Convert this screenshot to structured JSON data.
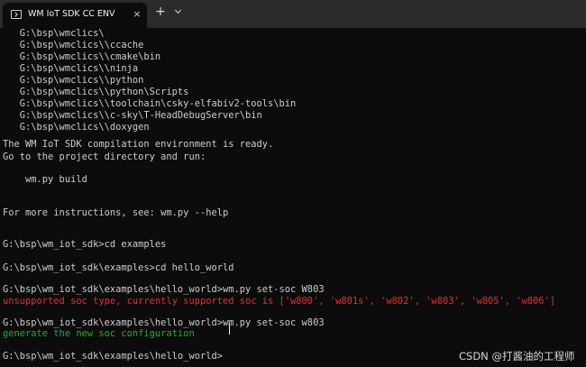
{
  "window": {
    "tab_title": "WM IoT SDK CC ENV",
    "tab_icon": "terminal-icon",
    "close_icon": "×",
    "new_tab_icon": "+",
    "dropdown_icon": "chevron-down-icon",
    "colors": {
      "background": "#0c0c0c",
      "text": "#cccccc",
      "error": "#e0322f",
      "success": "#1fae30"
    }
  },
  "terminal": {
    "lines": [
      "   G:\\bsp\\wmclics\\",
      "   G:\\bsp\\wmclics\\\\ccache",
      "   G:\\bsp\\wmclics\\\\cmake\\bin",
      "   G:\\bsp\\wmclics\\\\ninja",
      "   G:\\bsp\\wmclics\\\\python",
      "   G:\\bsp\\wmclics\\\\python\\Scripts",
      "   G:\\bsp\\wmclics\\\\toolchain\\csky-elfabiv2-tools\\bin",
      "   G:\\bsp\\wmclics\\\\c-sky\\T-HeadDebugServer\\bin",
      "   G:\\bsp\\wmclics\\\\doxygen",
      "The WM IoT SDK compilation environment is ready.",
      "Go to the project directory and run:",
      "    wm.py build",
      "For more instructions, see: wm.py --help",
      "G:\\bsp\\wm_iot_sdk>cd examples",
      "G:\\bsp\\wm_iot_sdk\\examples>cd hello_world",
      "G:\\bsp\\wm_iot_sdk\\examples\\hello_world>wm.py set-soc W803",
      "unsupported soc type, currently supported soc is ['w800', 'w801s', 'w802', 'w803', 'w805', 'w806']",
      "G:\\bsp\\wm_iot_sdk\\examples\\hello_world>wm.py set-soc w803",
      "generate the new soc configuration",
      "G:\\bsp\\wm_iot_sdk\\examples\\hello_world>"
    ]
  },
  "watermark": "CSDN @打酱油的工程师"
}
